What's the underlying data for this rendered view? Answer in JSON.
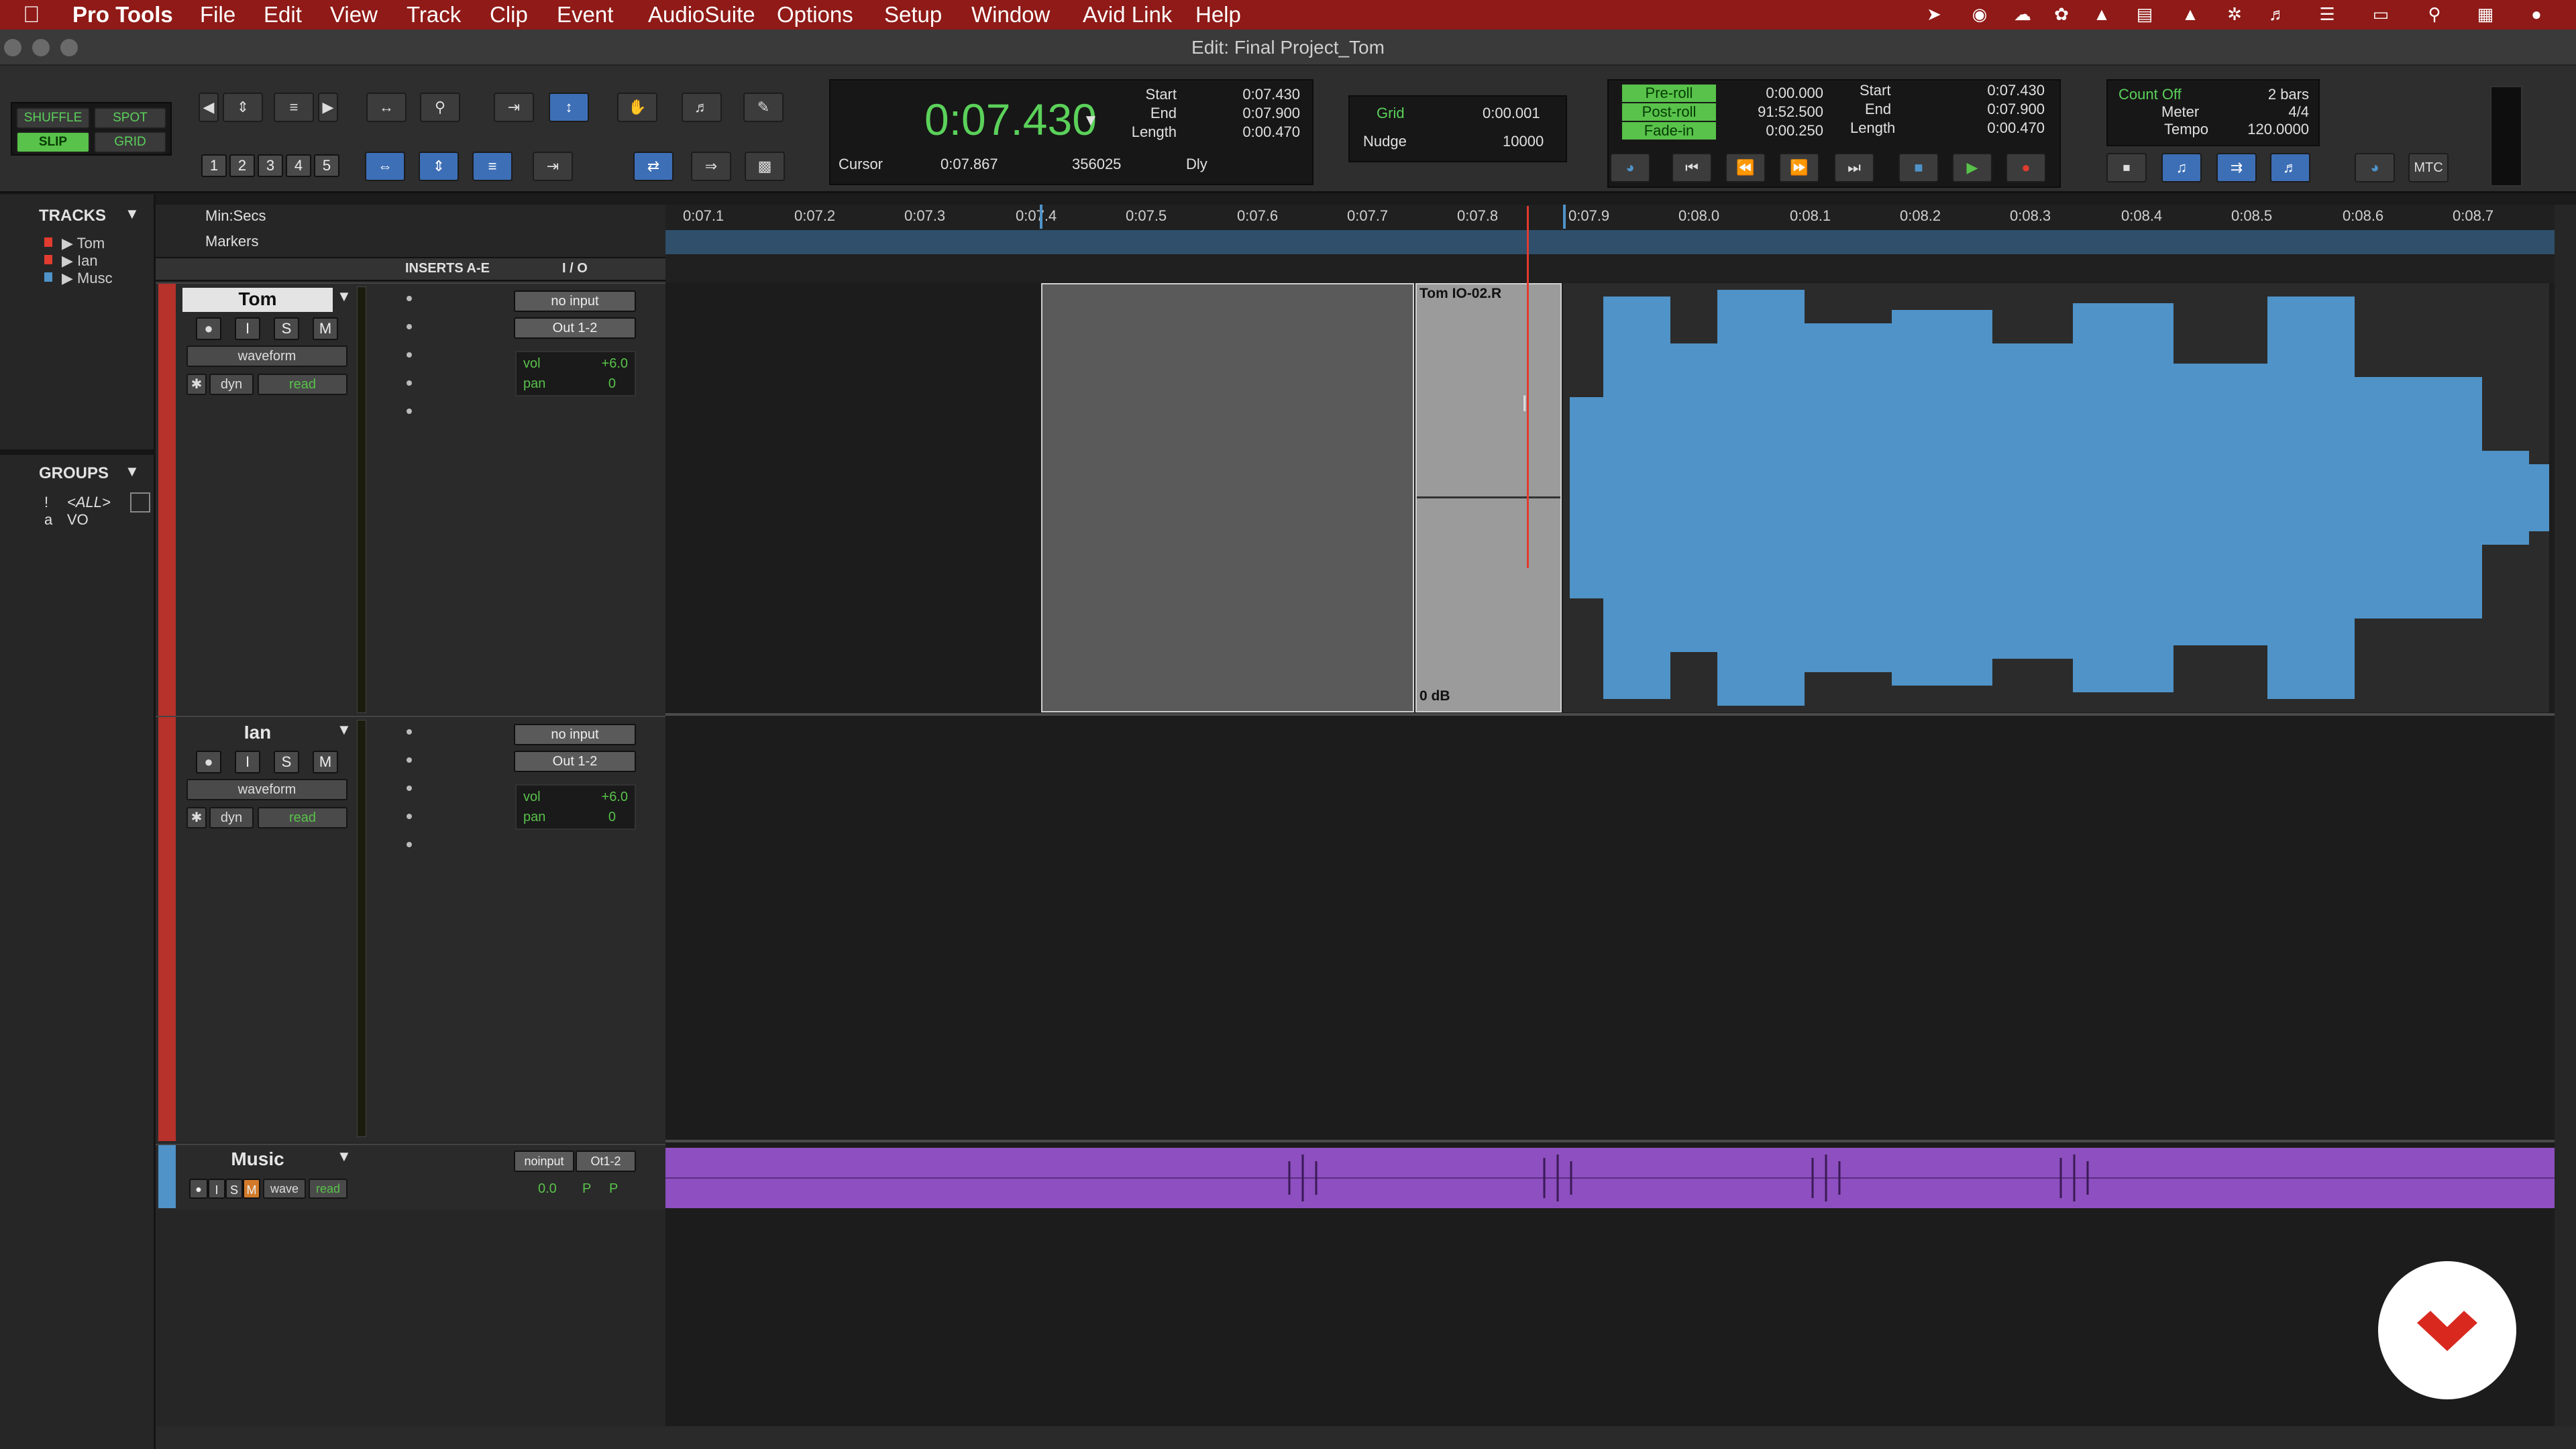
{
  "menubar": {
    "app": "Pro Tools",
    "items": [
      "File",
      "Edit",
      "View",
      "Track",
      "Clip",
      "Event",
      "AudioSuite",
      "Options",
      "Setup",
      "Window",
      "Avid Link",
      "Help"
    ]
  },
  "window": {
    "title": "Edit: Final Project_Tom"
  },
  "edit_modes": {
    "shuffle": "SHUFFLE",
    "spot": "SPOT",
    "slip": "SLIP",
    "grid": "GRID"
  },
  "zoom_presets": [
    "1",
    "2",
    "3",
    "4",
    "5"
  ],
  "counter": {
    "main": "0:07.430",
    "start_label": "Start",
    "end_label": "End",
    "length_label": "Length",
    "start": "0:07.430",
    "end": "0:07.900",
    "length": "0:00.470",
    "cursor_label": "Cursor",
    "cursor": "0:07.867",
    "sample": "356025",
    "dly": "Dly"
  },
  "grid": {
    "grid_label": "Grid",
    "grid_value": "0:00.001",
    "nudge_label": "Nudge",
    "nudge_value": "10000"
  },
  "transport_pre": {
    "preroll_label": "Pre-roll",
    "preroll": "0:00.000",
    "postroll_label": "Post-roll",
    "postroll": "91:52.500",
    "fadein_label": "Fade-in",
    "fadein": "0:00.250",
    "start_label": "Start",
    "start": "0:07.430",
    "end_label": "End",
    "end": "0:07.900",
    "length_label": "Length",
    "length": "0:00.470"
  },
  "midi": {
    "countoff_label": "Count Off",
    "countoff": "2 bars",
    "meter_label": "Meter",
    "meter": "4/4",
    "tempo_label": "Tempo",
    "tempo": "120.0000",
    "mtc": "MTC"
  },
  "tracks_panel": {
    "title": "TRACKS",
    "items": [
      "Tom",
      "Ian",
      "Musc"
    ]
  },
  "groups_panel": {
    "title": "GROUPS",
    "items": [
      {
        "id": "!",
        "name": "<ALL>"
      },
      {
        "id": "a",
        "name": "VO"
      }
    ]
  },
  "ruler": {
    "timebase": "Min:Secs",
    "markers": "Markers",
    "ticks": [
      "0:07.1",
      "0:07.2",
      "0:07.3",
      "0:07.4",
      "0:07.5",
      "0:07.6",
      "0:07.7",
      "0:07.8",
      "0:07.9",
      "0:08.0",
      "0:08.1",
      "0:08.2",
      "0:08.3",
      "0:08.4",
      "0:08.5",
      "0:08.6",
      "0:08.7"
    ]
  },
  "column_headers": {
    "inserts": "INSERTS A-E",
    "io": "I / O"
  },
  "tracks": [
    {
      "name": "Tom",
      "rec": "",
      "input": "I",
      "solo": "S",
      "mute": "M",
      "view": "waveform",
      "dyn": "dyn",
      "auto": "read",
      "in": "no input",
      "out": "Out 1-2",
      "vol_label": "vol",
      "vol": "+6.0",
      "pan_label": "pan",
      "pan": "0"
    },
    {
      "name": "Ian",
      "rec": "",
      "input": "I",
      "solo": "S",
      "mute": "M",
      "view": "waveform",
      "dyn": "dyn",
      "auto": "read",
      "in": "no input",
      "out": "Out 1-2",
      "vol_label": "vol",
      "vol": "+6.0",
      "pan_label": "pan",
      "pan": "0"
    },
    {
      "name": "Music",
      "in": "noinput",
      "out": "Ot1-2",
      "view": "wave",
      "auto": "read",
      "vol": "0.0",
      "p1": "P",
      "p2": "P",
      "solo": "S",
      "mute": "M",
      "input": "I"
    }
  ],
  "clip": {
    "name": "Tom IO-02.R",
    "gain": "0 dB"
  },
  "colors": {
    "menubar": "#8f1a17",
    "waveform": "#4f93c8",
    "music": "#8e4fc0",
    "green": "#58c24a",
    "track_red": "#b7322a"
  }
}
